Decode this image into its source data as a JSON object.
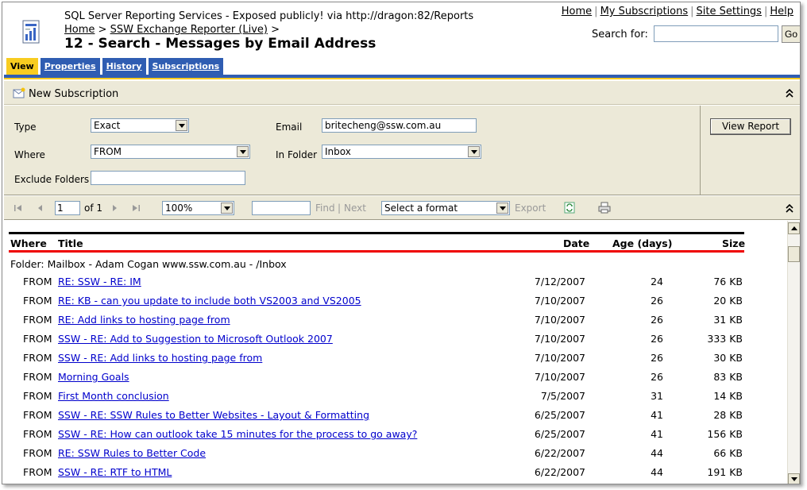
{
  "header": {
    "app_line": "SQL Server Reporting Services - Exposed publicly! via http://dragon:82/Reports",
    "breadcrumb_home": "Home",
    "breadcrumb_sep": ">",
    "breadcrumb_folder": "SSW Exchange Reporter (Live)",
    "breadcrumb_sep2": ">",
    "page_title": "12 - Search - Messages by Email Address",
    "links": {
      "home": "Home",
      "my_subscriptions": "My Subscriptions",
      "site_settings": "Site Settings",
      "help": "Help",
      "sep": "|"
    },
    "search_label": "Search for:",
    "search_value": "",
    "go_label": "Go"
  },
  "tabs": [
    {
      "label": "View",
      "active": true
    },
    {
      "label": "Properties",
      "active": false
    },
    {
      "label": "History",
      "active": false
    },
    {
      "label": "Subscriptions",
      "active": false
    }
  ],
  "subscription_bar": {
    "label": "New Subscription"
  },
  "params": {
    "type_label": "Type",
    "type_value": "Exact",
    "where_label": "Where",
    "where_value": "FROM",
    "exclude_label": "Exclude Folders",
    "exclude_value": "",
    "email_label": "Email",
    "email_value": "britecheng@ssw.com.au",
    "folder_label": "In Folder",
    "folder_value": "Inbox",
    "view_report_label": "View Report"
  },
  "toolbar": {
    "page_value": "1",
    "of_label": "of 1",
    "zoom_value": "100%",
    "find_value": "",
    "find_label": "Find",
    "sep": "|",
    "next_label": "Next",
    "format_value": "Select a format",
    "export_label": "Export"
  },
  "report": {
    "columns": {
      "where": "Where",
      "title": "Title",
      "date": "Date",
      "age": "Age (days)",
      "size": "Size"
    },
    "folder_line": "Folder: Mailbox - Adam Cogan www.ssw.com.au - /Inbox",
    "rows": [
      {
        "where": "FROM",
        "title": "RE: SSW - RE: IM",
        "date": "7/12/2007",
        "age": "24",
        "size": "76 KB"
      },
      {
        "where": "FROM",
        "title": "RE: KB - can you update to include both VS2003 and VS2005",
        "date": "7/10/2007",
        "age": "26",
        "size": "20 KB"
      },
      {
        "where": "FROM",
        "title": "RE: Add links to hosting page from ",
        "date": "7/10/2007",
        "age": "26",
        "size": "31 KB"
      },
      {
        "where": "FROM",
        "title": "SSW - RE: Add to Suggestion to Microsoft Outlook 2007",
        "date": "7/10/2007",
        "age": "26",
        "size": "333 KB"
      },
      {
        "where": "FROM",
        "title": "SSW - RE: Add links to hosting page from ",
        "date": "7/10/2007",
        "age": "26",
        "size": "30 KB"
      },
      {
        "where": "FROM",
        "title": "Morning Goals",
        "date": "7/10/2007",
        "age": "26",
        "size": "83 KB"
      },
      {
        "where": "FROM",
        "title": "First Month conclusion",
        "date": "7/5/2007",
        "age": "31",
        "size": "14 KB"
      },
      {
        "where": "FROM",
        "title": "SSW - RE: SSW Rules to Better Websites - Layout & Formatting",
        "date": "6/25/2007",
        "age": "41",
        "size": "28 KB"
      },
      {
        "where": "FROM",
        "title": "SSW - RE: How can outlook take 15 minutes for the process to go away?",
        "date": "6/25/2007",
        "age": "41",
        "size": "156 KB"
      },
      {
        "where": "FROM",
        "title": "RE: SSW Rules to Better Code",
        "date": "6/22/2007",
        "age": "44",
        "size": "66 KB"
      },
      {
        "where": "FROM",
        "title": "SSW - RE: RTF to HTML",
        "date": "6/22/2007",
        "age": "44",
        "size": "191 KB"
      }
    ]
  },
  "colors": {
    "tab_blue": "#2f5db2",
    "tab_active": "#f8cc20",
    "panel_bg": "#ece9d8",
    "link": "#0000cc",
    "header_rule_red": "#e00000"
  },
  "icons": [
    "report-server-icon",
    "new-subscription-icon",
    "collapse-icon",
    "first-page-icon",
    "prev-page-icon",
    "next-page-icon",
    "last-page-icon",
    "refresh-icon",
    "print-icon"
  ]
}
